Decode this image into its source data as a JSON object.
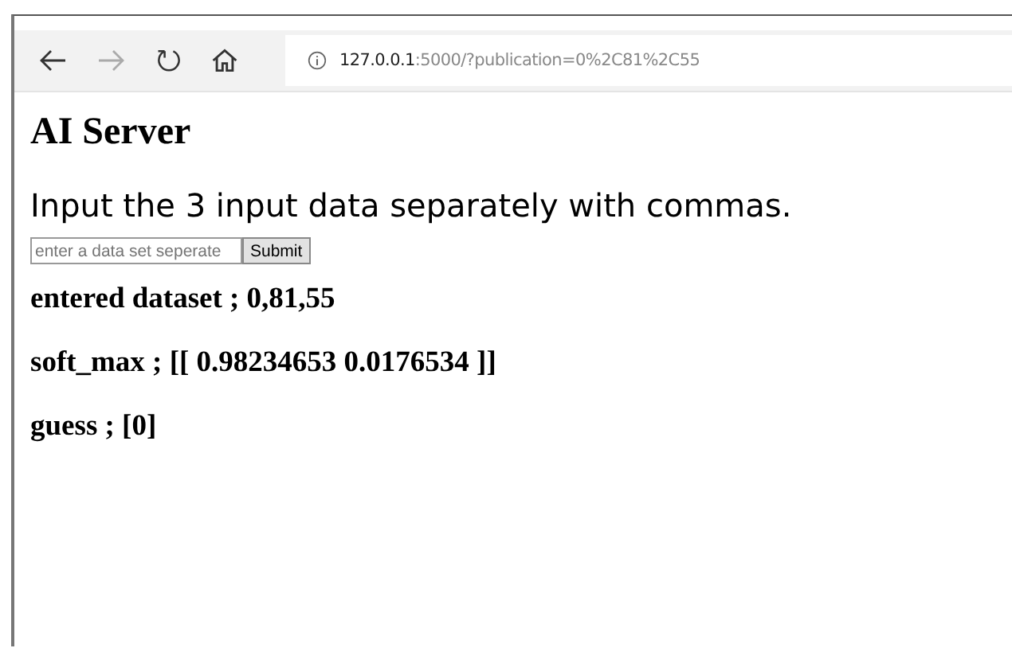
{
  "browser": {
    "url_host": "127.0.0.1",
    "url_rest": ":5000/?publication=0%2C81%2C55"
  },
  "page": {
    "title": "AI Server",
    "instruction": "Input the 3 input data separately with commas.",
    "input": {
      "placeholder": "enter a data set seperate"
    },
    "submit": "Submit",
    "results": [
      "entered dataset ; 0,81,55",
      "soft_max ; [[ 0.98234653 0.0176534 ]]",
      "guess ; [0]"
    ]
  }
}
